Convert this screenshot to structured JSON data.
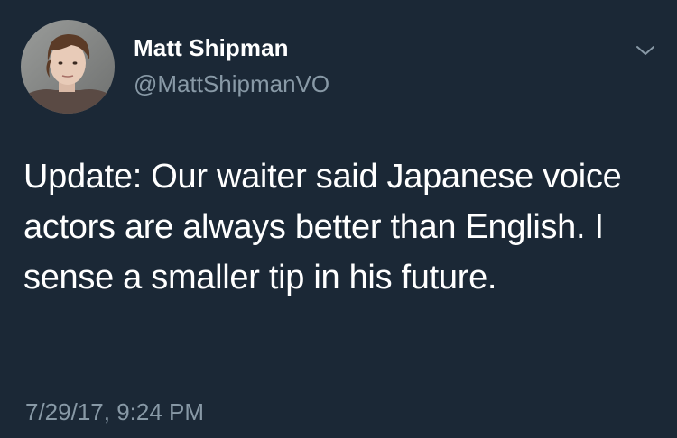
{
  "tweet": {
    "author": {
      "display_name": "Matt Shipman",
      "handle": "@MattShipmanVO",
      "avatar": "profile-photo"
    },
    "text": "Update: Our waiter said Japanese voice actors are always better than English. I sense a smaller tip in his future.",
    "timestamp": "7/29/17, 9:24 PM",
    "menu_icon": "chevron-down-icon"
  },
  "colors": {
    "background": "#1b2836",
    "primary_text": "#ffffff",
    "secondary_text": "#8899a6"
  }
}
